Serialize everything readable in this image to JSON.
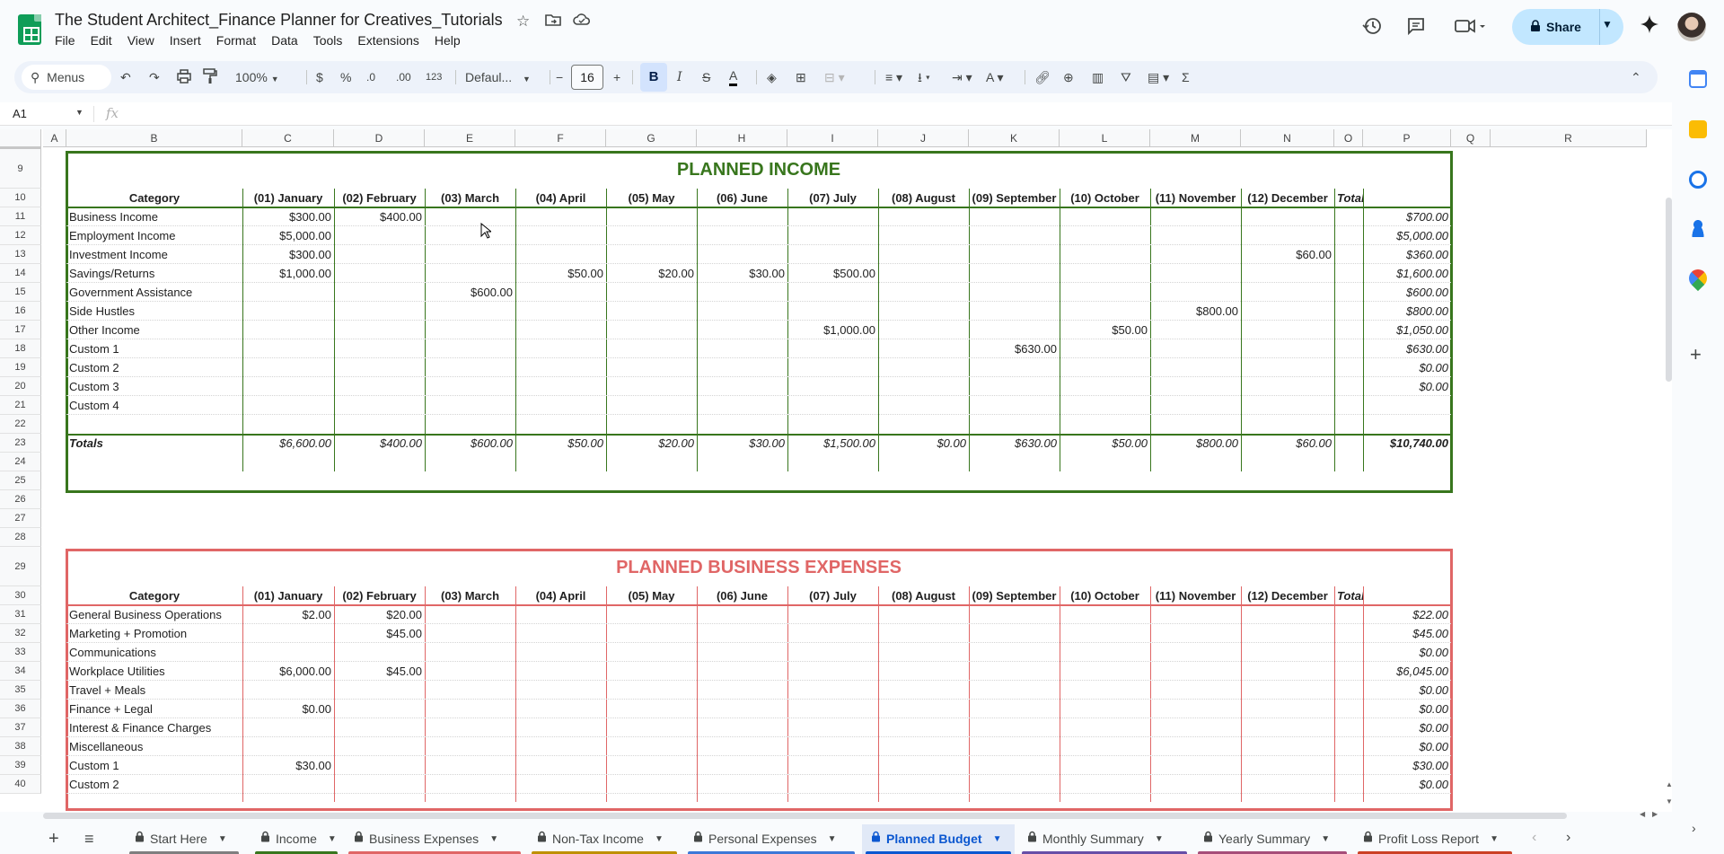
{
  "app": {
    "doc_title": "The Student Architect_Finance Planner for Creatives_Tutorials",
    "menu": [
      "File",
      "Edit",
      "View",
      "Insert",
      "Format",
      "Data",
      "Tools",
      "Extensions",
      "Help"
    ],
    "share_label": "Share"
  },
  "toolbar": {
    "search_label": "Menus",
    "zoom": "100%",
    "currency": "$",
    "percent": "%",
    "dec_minus": ".0",
    "dec_plus": ".00",
    "format_123": "123",
    "font": "Defaul...",
    "font_size": "16",
    "bold": "B",
    "italic": "I",
    "sigma": "Σ"
  },
  "formula": {
    "cell_ref": "A1",
    "fx": "fx"
  },
  "columns": [
    "A",
    "B",
    "C",
    "D",
    "E",
    "F",
    "G",
    "H",
    "I",
    "J",
    "K",
    "L",
    "M",
    "N",
    "O",
    "P",
    "Q",
    "R"
  ],
  "rows": [
    "9",
    "10",
    "11",
    "12",
    "13",
    "14",
    "15",
    "16",
    "17",
    "18",
    "19",
    "20",
    "21",
    "22",
    "23",
    "24",
    "25",
    "26",
    "27",
    "28",
    "29",
    "30",
    "31",
    "32",
    "33",
    "34",
    "35",
    "36",
    "37",
    "38",
    "39",
    "40"
  ],
  "month_headers": [
    "Category",
    "(01) January",
    "(02) February",
    "(03) March",
    "(04) April",
    "(05) May",
    "(06) June",
    "(07) July",
    "(08) August",
    "(09) September",
    "(10) October",
    "(11) November",
    "(12) December",
    "Totals"
  ],
  "income": {
    "title": "PLANNED INCOME",
    "color": "#38761d",
    "rows": [
      {
        "label": "Business Income",
        "values": [
          "$300.00",
          "$400.00",
          "",
          "",
          "",
          "",
          "",
          "",
          "",
          "",
          "",
          ""
        ],
        "total": "$700.00"
      },
      {
        "label": "Employment Income",
        "values": [
          "$5,000.00",
          "",
          "",
          "",
          "",
          "",
          "",
          "",
          "",
          "",
          "",
          ""
        ],
        "total": "$5,000.00"
      },
      {
        "label": "Investment Income",
        "values": [
          "$300.00",
          "",
          "",
          "",
          "",
          "",
          "",
          "",
          "",
          "",
          "",
          "$60.00"
        ],
        "total": "$360.00"
      },
      {
        "label": "Savings/Returns",
        "values": [
          "$1,000.00",
          "",
          "",
          "$50.00",
          "$20.00",
          "$30.00",
          "$500.00",
          "",
          "",
          "",
          "",
          ""
        ],
        "total": "$1,600.00"
      },
      {
        "label": "Government Assistance",
        "values": [
          "",
          "",
          "$600.00",
          "",
          "",
          "",
          "",
          "",
          "",
          "",
          "",
          ""
        ],
        "total": "$600.00"
      },
      {
        "label": "Side Hustles",
        "values": [
          "",
          "",
          "",
          "",
          "",
          "",
          "",
          "",
          "",
          "",
          "$800.00",
          ""
        ],
        "total": "$800.00"
      },
      {
        "label": "Other Income",
        "values": [
          "",
          "",
          "",
          "",
          "",
          "",
          "$1,000.00",
          "",
          "",
          "$50.00",
          "",
          ""
        ],
        "total": "$1,050.00"
      },
      {
        "label": "Custom 1",
        "values": [
          "",
          "",
          "",
          "",
          "",
          "",
          "",
          "",
          "$630.00",
          "",
          "",
          ""
        ],
        "total": "$630.00"
      },
      {
        "label": "Custom 2",
        "values": [
          "",
          "",
          "",
          "",
          "",
          "",
          "",
          "",
          "",
          "",
          "",
          ""
        ],
        "total": "$0.00"
      },
      {
        "label": "Custom 3",
        "values": [
          "",
          "",
          "",
          "",
          "",
          "",
          "",
          "",
          "",
          "",
          "",
          ""
        ],
        "total": "$0.00"
      },
      {
        "label": "Custom 4",
        "values": [
          "",
          "",
          "",
          "",
          "",
          "",
          "",
          "",
          "",
          "",
          "",
          ""
        ],
        "total": ""
      }
    ],
    "totals_label": "Totals",
    "totals": [
      "$6,600.00",
      "$400.00",
      "$600.00",
      "$50.00",
      "$20.00",
      "$30.00",
      "$1,500.00",
      "$0.00",
      "$630.00",
      "$50.00",
      "$800.00",
      "$60.00"
    ],
    "grand_total": "$10,740.00"
  },
  "expenses": {
    "title": "PLANNED BUSINESS EXPENSES",
    "color": "#e06666",
    "rows": [
      {
        "label": "General Business Operations",
        "values": [
          "$2.00",
          "$20.00",
          "",
          "",
          "",
          "",
          "",
          "",
          "",
          "",
          "",
          ""
        ],
        "total": "$22.00"
      },
      {
        "label": "Marketing + Promotion",
        "values": [
          "",
          "$45.00",
          "",
          "",
          "",
          "",
          "",
          "",
          "",
          "",
          "",
          ""
        ],
        "total": "$45.00"
      },
      {
        "label": "Communications",
        "values": [
          "",
          "",
          "",
          "",
          "",
          "",
          "",
          "",
          "",
          "",
          "",
          ""
        ],
        "total": "$0.00"
      },
      {
        "label": "Workplace Utilities",
        "values": [
          "$6,000.00",
          "$45.00",
          "",
          "",
          "",
          "",
          "",
          "",
          "",
          "",
          "",
          ""
        ],
        "total": "$6,045.00"
      },
      {
        "label": "Travel + Meals",
        "values": [
          "",
          "",
          "",
          "",
          "",
          "",
          "",
          "",
          "",
          "",
          "",
          ""
        ],
        "total": "$0.00"
      },
      {
        "label": "Finance + Legal",
        "values": [
          "$0.00",
          "",
          "",
          "",
          "",
          "",
          "",
          "",
          "",
          "",
          "",
          ""
        ],
        "total": "$0.00"
      },
      {
        "label": "Interest & Finance Charges",
        "values": [
          "",
          "",
          "",
          "",
          "",
          "",
          "",
          "",
          "",
          "",
          "",
          ""
        ],
        "total": "$0.00"
      },
      {
        "label": "Miscellaneous",
        "values": [
          "",
          "",
          "",
          "",
          "",
          "",
          "",
          "",
          "",
          "",
          "",
          ""
        ],
        "total": "$0.00"
      },
      {
        "label": "Custom 1",
        "values": [
          "$30.00",
          "",
          "",
          "",
          "",
          "",
          "",
          "",
          "",
          "",
          "",
          ""
        ],
        "total": "$30.00"
      },
      {
        "label": "Custom 2",
        "values": [
          "",
          "",
          "",
          "",
          "",
          "",
          "",
          "",
          "",
          "",
          "",
          ""
        ],
        "total": "$0.00"
      }
    ]
  },
  "sheet_tabs": [
    {
      "label": "Start Here",
      "color": "#7f7f7f",
      "locked": true
    },
    {
      "label": "Income",
      "color": "#38761d",
      "locked": true
    },
    {
      "label": "Business Expenses",
      "color": "#e06666",
      "locked": true
    },
    {
      "label": "Non-Tax Income",
      "color": "#bf9000",
      "locked": true
    },
    {
      "label": "Personal Expenses",
      "color": "#3c78d8",
      "locked": true
    },
    {
      "label": "Planned Budget",
      "color": "#0b57d0",
      "locked": true,
      "active": true
    },
    {
      "label": "Monthly Summary",
      "color": "#674ea7",
      "locked": true
    },
    {
      "label": "Yearly Summary",
      "color": "#a64d79",
      "locked": true
    },
    {
      "label": "Profit Loss Report",
      "color": "#cc4125",
      "locked": true
    }
  ]
}
